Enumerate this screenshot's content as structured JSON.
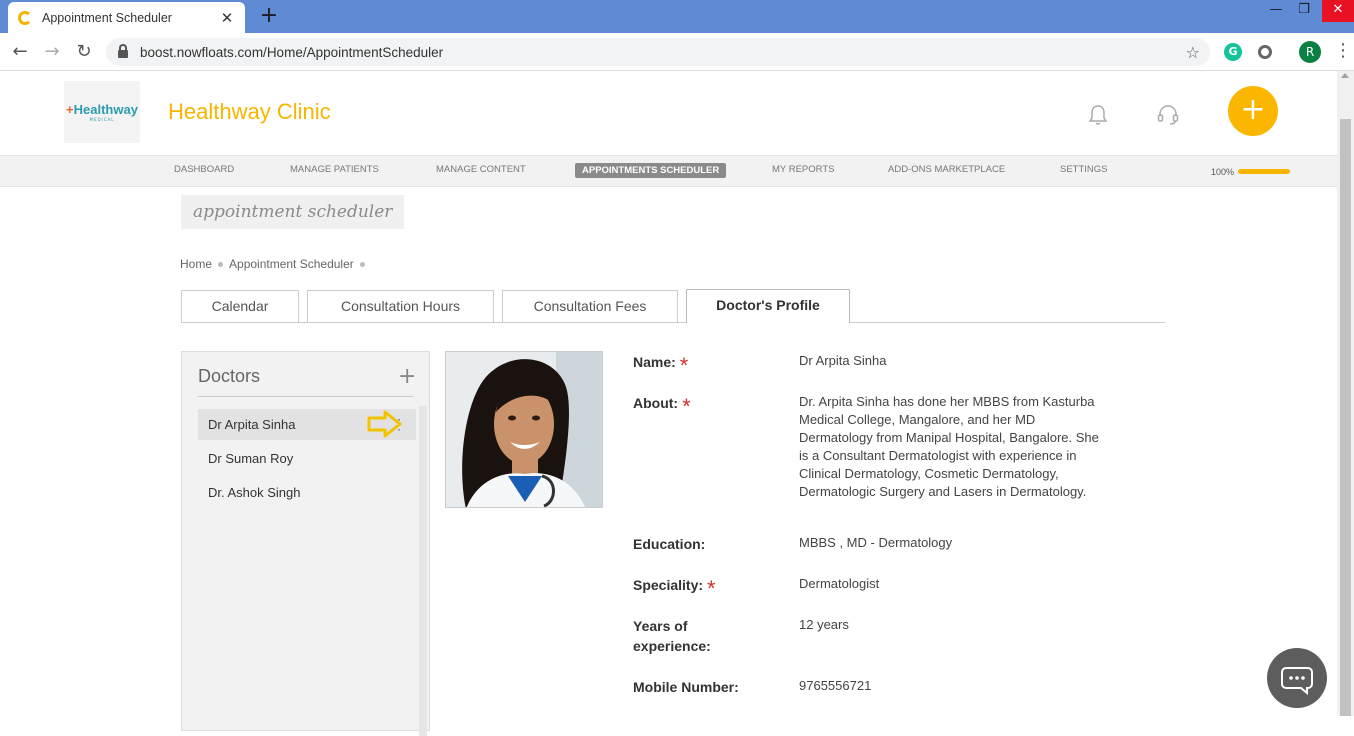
{
  "browser": {
    "tab_title": "Appointment Scheduler",
    "tab_close": "✕",
    "new_tab": "+",
    "url": "boost.nowfloats.com/Home/AppointmentScheduler",
    "profile_initial": "R",
    "extension_label": "G"
  },
  "header": {
    "logo_text": "Healthway",
    "logo_subtext": "MEDICAL",
    "clinic_name": "Healthway Clinic",
    "add_label": "+"
  },
  "nav": {
    "items": [
      "DASHBOARD",
      "MANAGE PATIENTS",
      "MANAGE CONTENT",
      "APPOINTMENTS SCHEDULER",
      "MY REPORTS",
      "ADD-ONS MARKETPLACE",
      "SETTINGS"
    ],
    "active_index": 3,
    "progress_label": "100%",
    "progress_value": 1.0
  },
  "page": {
    "heading": "appointment scheduler",
    "breadcrumb": [
      "Home",
      "Appointment Scheduler"
    ]
  },
  "tabs": [
    "Calendar",
    "Consultation Hours",
    "Consultation Fees",
    "Doctor's Profile"
  ],
  "doctors": {
    "title": "Doctors",
    "add_label": "+",
    "list": [
      "Dr Arpita Sinha",
      "Dr Suman Roy",
      "Dr. Ashok Singh"
    ],
    "selected_index": 0
  },
  "profile": {
    "name_label": "Name:",
    "name": "Dr Arpita Sinha",
    "about_label": "About:",
    "about": "Dr. Arpita Sinha has done her MBBS from Kasturba Medical College, Mangalore, and her MD Dermatology from Manipal Hospital, Bangalore. She is a Consultant Dermatologist with experience in Clinical Dermatology, Cosmetic Dermatology, Dermatologic Surgery and Lasers in Dermatology.",
    "education_label": "Education:",
    "education": "MBBS , MD - Dermatology",
    "speciality_label": "Speciality:",
    "speciality": "Dermatologist",
    "experience_label": "Years of experience:",
    "experience": "12 years",
    "mobile_label": "Mobile Number:",
    "mobile": "9765556721",
    "required_mark": "*"
  },
  "colors": {
    "accent": "#f7b500",
    "titlebar": "#5f8ad4",
    "required": "#d23030",
    "arrow": "#f2c300"
  }
}
